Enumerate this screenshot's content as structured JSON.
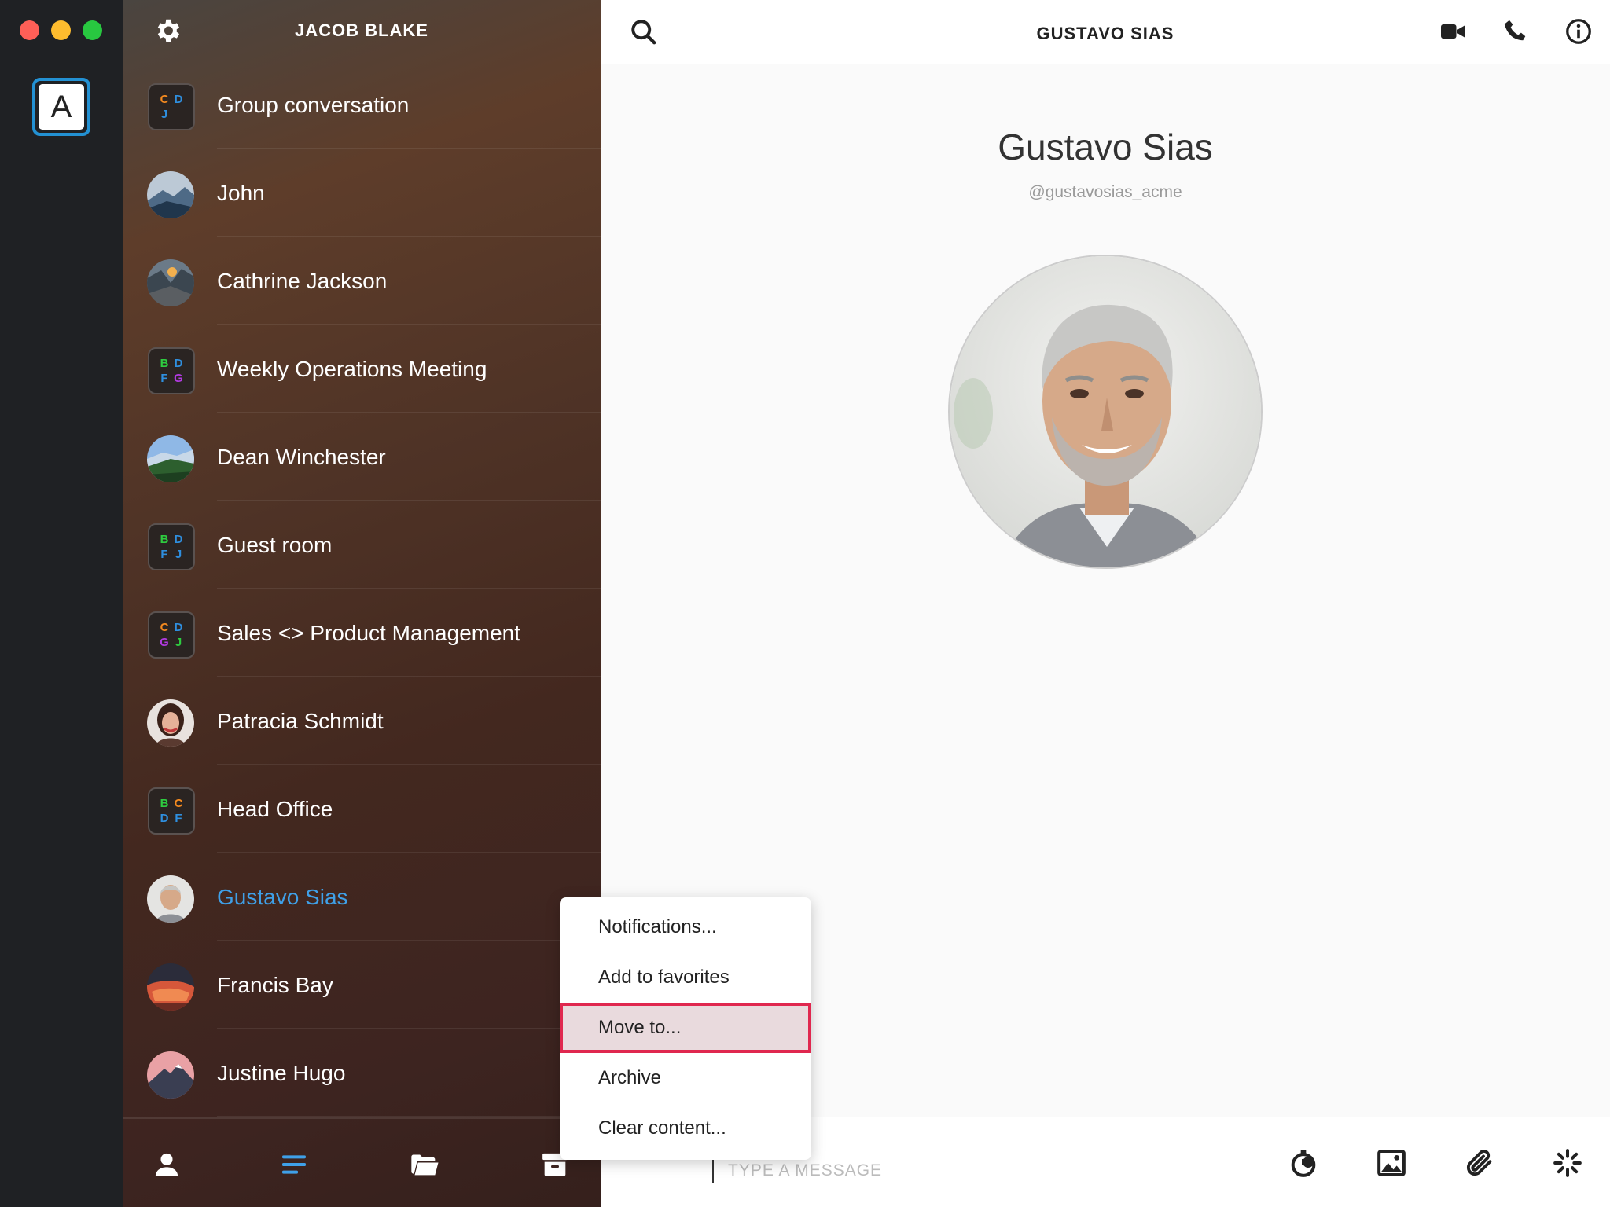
{
  "account": {
    "initial": "A"
  },
  "sidebar": {
    "title": "JACOB BLAKE",
    "conversations": [
      {
        "name": "Group conversation",
        "type": "group",
        "letters": [
          [
            "C",
            "#f58a1f"
          ],
          [
            "D",
            "#2f8fdf"
          ],
          [
            "J",
            "#2f8fdf"
          ],
          [
            "",
            ""
          ]
        ]
      },
      {
        "name": "John",
        "type": "person",
        "avatar": "mountain"
      },
      {
        "name": "Cathrine Jackson",
        "type": "person",
        "avatar": "valley"
      },
      {
        "name": "Weekly Operations Meeting",
        "type": "group",
        "letters": [
          [
            "B",
            "#2ecc40"
          ],
          [
            "D",
            "#2f8fdf"
          ],
          [
            "F",
            "#2f8fdf"
          ],
          [
            "G",
            "#b03adf"
          ]
        ]
      },
      {
        "name": "Dean Winchester",
        "type": "person",
        "avatar": "forest"
      },
      {
        "name": "Guest room",
        "type": "group",
        "letters": [
          [
            "B",
            "#2ecc40"
          ],
          [
            "D",
            "#2f8fdf"
          ],
          [
            "F",
            "#2f8fdf"
          ],
          [
            "J",
            "#2f8fdf"
          ]
        ]
      },
      {
        "name": "Sales <> Product Management",
        "type": "group",
        "letters": [
          [
            "C",
            "#f58a1f"
          ],
          [
            "D",
            "#2f8fdf"
          ],
          [
            "G",
            "#b03adf"
          ],
          [
            "J",
            "#2ecc40"
          ]
        ]
      },
      {
        "name": "Patracia Schmidt",
        "type": "person",
        "avatar": "woman"
      },
      {
        "name": "Head Office",
        "type": "group",
        "letters": [
          [
            "B",
            "#2ecc40"
          ],
          [
            "C",
            "#f58a1f"
          ],
          [
            "D",
            "#2f8fdf"
          ],
          [
            "F",
            "#2f8fdf"
          ]
        ]
      },
      {
        "name": "Gustavo Sias",
        "type": "person",
        "avatar": "man",
        "active": true
      },
      {
        "name": "Francis Bay",
        "type": "person",
        "avatar": "canyon"
      },
      {
        "name": "Justine Hugo",
        "type": "person",
        "avatar": "peak"
      }
    ]
  },
  "header": {
    "title": "GUSTAVO SIAS"
  },
  "profile": {
    "name": "Gustavo Sias",
    "handle": "@gustavosias_acme"
  },
  "composer": {
    "placeholder": "TYPE A MESSAGE"
  },
  "context_menu": {
    "items": [
      "Notifications...",
      "Add to favorites",
      "Move to...",
      "Archive",
      "Clear content..."
    ],
    "highlighted_index": 2
  },
  "colors": {
    "accent": "#3fa0e8",
    "highlight_border": "#e0284f",
    "highlight_bg": "#e9dadd"
  },
  "icons": {
    "rail": [
      "account-icon"
    ],
    "sidebar_footer": [
      "contacts-icon",
      "conversations-icon",
      "folder-icon",
      "archive-icon"
    ],
    "topbar": [
      "search-icon",
      "video-call-icon",
      "phone-icon",
      "info-icon"
    ],
    "composer": [
      "timer-icon",
      "image-icon",
      "attachment-icon",
      "ping-icon"
    ]
  }
}
